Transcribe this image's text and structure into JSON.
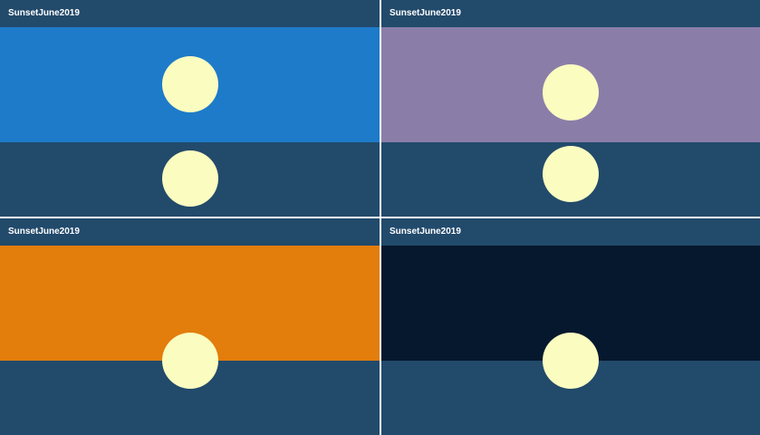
{
  "app_title": "SunsetJune2019",
  "colors": {
    "header": "#224a6b",
    "sea": "#224a6b",
    "sun": "#fbfcc0",
    "divider": "#ffffff"
  },
  "panels": [
    {
      "title": "SunsetJune2019",
      "sky_color": "#1e7bc9",
      "stage": "day"
    },
    {
      "title": "SunsetJune2019",
      "sky_color": "#8a7ea9",
      "stage": "dusk"
    },
    {
      "title": "SunsetJune2019",
      "sky_color": "#e37d0b",
      "stage": "sunset"
    },
    {
      "title": "SunsetJune2019",
      "sky_color": "#06182d",
      "stage": "night"
    }
  ]
}
